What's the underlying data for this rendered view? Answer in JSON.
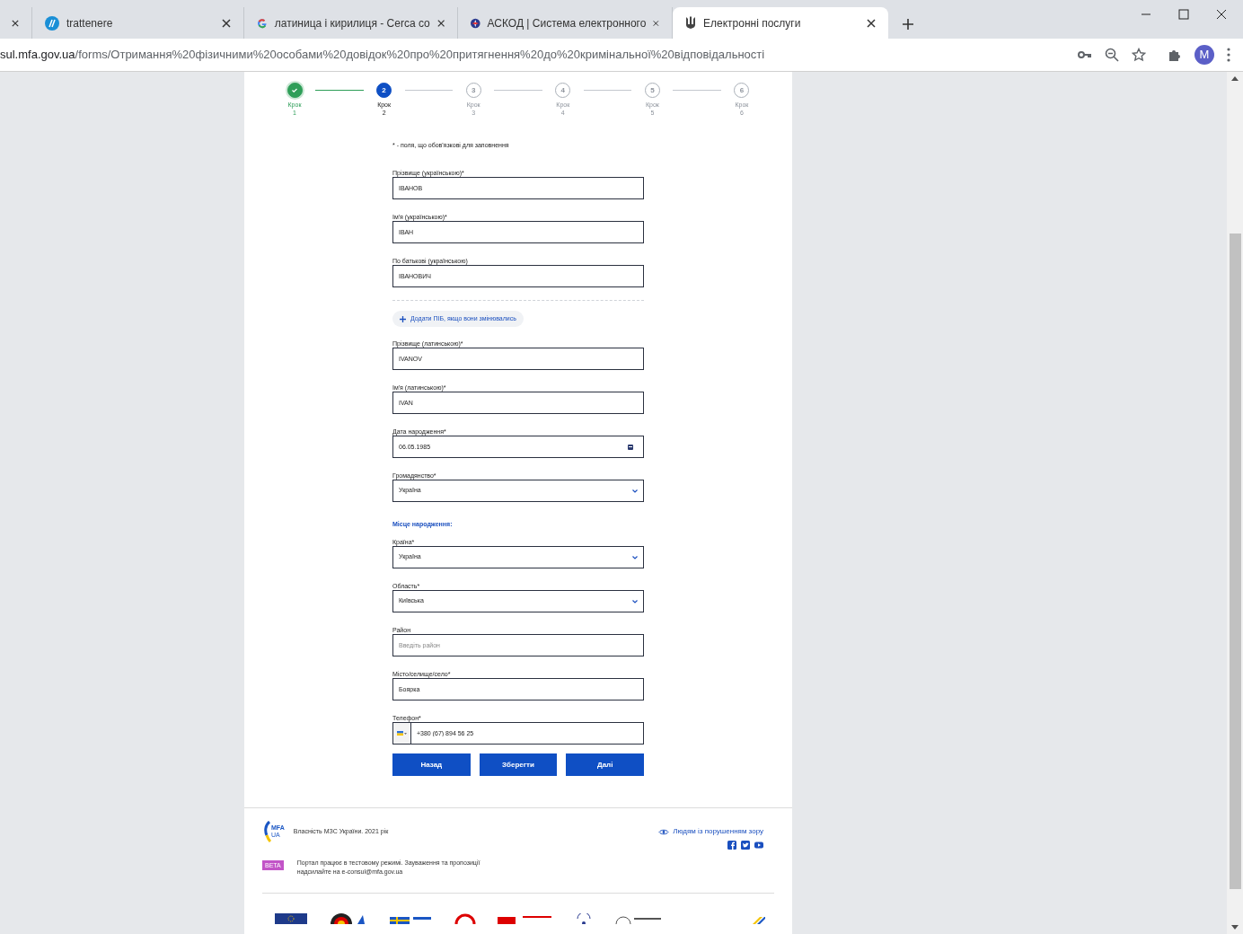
{
  "browser": {
    "tabs": [
      {
        "selected": false
      },
      {
        "title": "trattenere",
        "selected": false
      },
      {
        "title": "латиница і кирилиця - Cerca co",
        "selected": false
      },
      {
        "title": "АСКОД | Система електронного",
        "selected": false
      },
      {
        "title": "Електронні послуги",
        "selected": true
      }
    ],
    "url_host": "sul.mfa.gov.ua",
    "url_path": "/forms/Отримання%20фізичними%20особами%20довідок%20про%20притягнення%20до%20кримінальної%20відповідальності",
    "profile": "M"
  },
  "steps": [
    {
      "label": "Крок",
      "number": "1",
      "completed": true,
      "selected": false
    },
    {
      "circle_text": "2",
      "label": "Крок",
      "number": "2",
      "completed": false,
      "selected": true
    },
    {
      "circle_text": "3",
      "label": "Крок",
      "number": "3",
      "completed": false,
      "selected": false
    },
    {
      "circle_text": "4",
      "label": "Крок",
      "number": "4",
      "completed": false,
      "selected": false
    },
    {
      "circle_text": "5",
      "label": "Крок",
      "number": "5",
      "completed": false,
      "selected": false
    },
    {
      "circle_text": "6",
      "label": "Крок",
      "number": "6",
      "completed": false,
      "selected": false
    }
  ],
  "required_note": "* - поля, що обов'язкові для заповнення",
  "form": [
    {
      "kind": "text",
      "label": "Прізвище (українською)*",
      "value": "ІВАНОВ"
    },
    {
      "kind": "text",
      "label": "Ім'я (українською)*",
      "value": "ІВАН"
    },
    {
      "kind": "text",
      "label": "По батькові (українською)",
      "value": "ІВАНОВИЧ"
    },
    {
      "kind": "add",
      "label": "Додати ПІБ, якщо вони змінювались"
    },
    {
      "kind": "text",
      "label": "Прізвище (латинською)*",
      "value": "IVANOV"
    },
    {
      "kind": "text",
      "label": "Ім'я (латинською)*",
      "value": "IVAN"
    },
    {
      "kind": "date",
      "label": "Дата народження*",
      "value": "06.05.1985"
    },
    {
      "kind": "select",
      "label": "Громадянство*",
      "value": "Україна"
    },
    {
      "kind": "heading",
      "label": "Місце народження:"
    },
    {
      "kind": "select",
      "label": "Країна*",
      "value": "Україна"
    },
    {
      "kind": "select",
      "label": "Область*",
      "value": "Київська"
    },
    {
      "kind": "text",
      "label": "Район",
      "placeholder": "Введіть район"
    },
    {
      "kind": "text",
      "label": "Місто/селище/село*",
      "value": "Боярка"
    },
    {
      "kind": "phone",
      "label": "Телефон*",
      "value": "+380 (67) 894 56 25"
    }
  ],
  "buttons": [
    "Назад",
    "Зберегти",
    "Далі"
  ],
  "footer": {
    "logo_text": [
      "MFA",
      "UA"
    ],
    "copyright": "Власність МЗС України. 2021 рік",
    "badge": "BETA",
    "notice": "Портал працює в тестовому режимі. Зауваження та пропозиції надсилайте на e-consul@mfa.gov.ua",
    "accessibility_link": "Людям із порушенням зору"
  }
}
